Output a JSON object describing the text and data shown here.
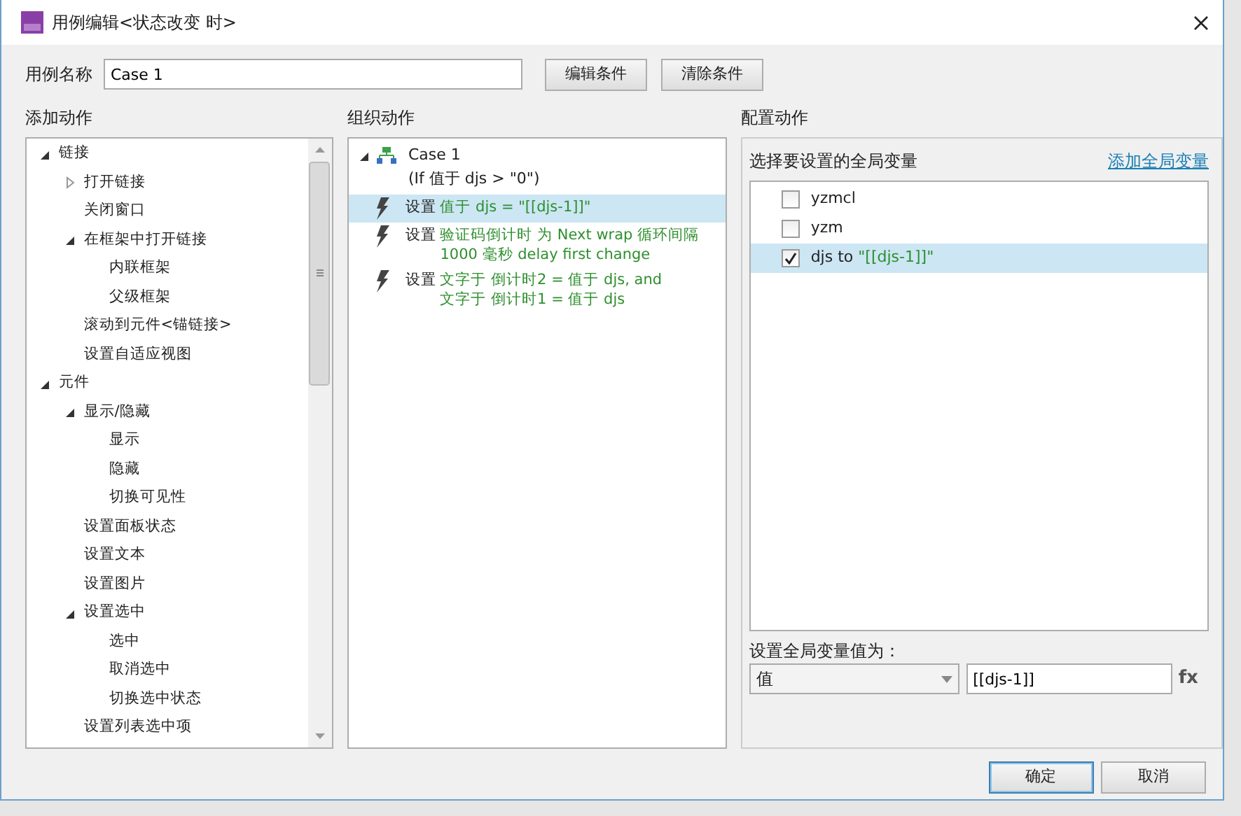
{
  "window": {
    "title": "用例编辑<状态改变 时>"
  },
  "case_name": {
    "label": "用例名称",
    "value": "Case 1"
  },
  "top_buttons": [
    "编辑条件",
    "清除条件"
  ],
  "add_actions": {
    "heading": "添加动作",
    "tree": [
      {
        "label": "链接",
        "expanded": true,
        "children": [
          {
            "label": "打开链接",
            "expanded": false
          },
          {
            "label": "关闭窗口"
          },
          {
            "label": "在框架中打开链接",
            "expanded": true,
            "children": [
              {
                "label": "内联框架"
              },
              {
                "label": "父级框架"
              }
            ]
          },
          {
            "label": "滚动到元件<锚链接>"
          },
          {
            "label": "设置自适应视图"
          }
        ]
      },
      {
        "label": "元件",
        "expanded": true,
        "children": [
          {
            "label": "显示/隐藏",
            "expanded": true,
            "children": [
              {
                "label": "显示"
              },
              {
                "label": "隐藏"
              },
              {
                "label": "切换可见性"
              }
            ]
          },
          {
            "label": "设置面板状态"
          },
          {
            "label": "设置文本"
          },
          {
            "label": "设置图片"
          },
          {
            "label": "设置选中",
            "expanded": true,
            "children": [
              {
                "label": "选中"
              },
              {
                "label": "取消选中"
              },
              {
                "label": "切换选中状态"
              }
            ]
          },
          {
            "label": "设置列表选中项"
          }
        ]
      }
    ]
  },
  "organize_actions": {
    "heading": "组织动作",
    "case": {
      "title": "Case 1",
      "condition": "(If 值于 djs > \"0\")",
      "expanded": true
    },
    "actions": [
      {
        "verb": "设置",
        "detail": [
          "值于 djs = \"[[djs-1]]\""
        ],
        "selected": true
      },
      {
        "verb": "设置",
        "detail": [
          "验证码倒计时 为 Next wrap 循环间隔",
          "1000 毫秒 delay first change"
        ],
        "selected": false
      },
      {
        "verb": "设置",
        "detail": [
          "文字于 倒计时2 = 值于 djs, and",
          "文字于 倒计时1 = 值于 djs"
        ],
        "selected": false
      }
    ]
  },
  "configure_actions": {
    "heading": "配置动作",
    "prompt": "选择要设置的全局变量",
    "add_link": "添加全局变量",
    "variables": [
      {
        "label": "yzmcl",
        "checked": false,
        "selected": false
      },
      {
        "label": "yzm",
        "checked": false,
        "selected": false
      },
      {
        "label": "djs to",
        "value": "\"[[djs-1]]\"",
        "checked": true,
        "selected": true
      }
    ],
    "value_label": "设置全局变量值为：",
    "value_type": "值",
    "value": "[[djs-1]]",
    "fx": "fx"
  },
  "buttons": [
    {
      "label": "确定",
      "default": true
    },
    {
      "label": "取消",
      "default": false
    }
  ]
}
